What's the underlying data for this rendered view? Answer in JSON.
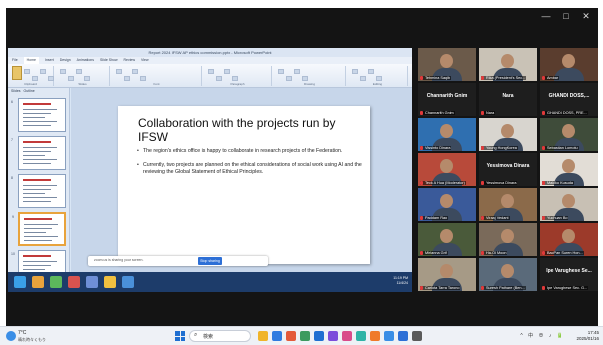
{
  "window": {
    "controls": [
      "—",
      "□",
      "✕"
    ]
  },
  "powerpoint": {
    "title": "Report 2024 IFSW AP ethics commission.pptx - Microsoft PowerPoint",
    "tabs": [
      "File",
      "Home",
      "Insert",
      "Design",
      "Animations",
      "Slide Show",
      "Review",
      "View"
    ],
    "active_tab": "Home",
    "ribbon_groups": [
      "Clipboard",
      "Slides",
      "Font",
      "Paragraph",
      "Drawing",
      "Editing"
    ],
    "thumb_tabs": [
      "Slides",
      "Outline"
    ],
    "thumb_numbers": [
      "6",
      "7",
      "8",
      "9",
      "10"
    ],
    "slide": {
      "title": "Collaboration with the projects run by IFSW",
      "bullets": [
        "The region's ethics office is happy to collaborate in research projects of the Federation.",
        "Currently, two projects are planned on the ethical considerations of social work using AI and the reviewing the Global Statement of Ethical Principles."
      ]
    },
    "notes_placeholder": "Click to add notes",
    "share_bar": {
      "text": "zoom.us is sharing your screen.",
      "stop_label": "Stop sharing"
    },
    "inner_clock": {
      "time": "11:19 PM",
      "date": "11/4/24"
    }
  },
  "gallery": {
    "tiles": [
      {
        "name": "Tehmina Saqib",
        "kind": "cam",
        "bg": "#6b5a4a"
      },
      {
        "name": "Rika (President's Sec...",
        "kind": "cam",
        "bg": "#c9c2b6"
      },
      {
        "name": "Ambar",
        "kind": "cam",
        "bg": "#5a3d2e"
      },
      {
        "name": "Channarith Gnim",
        "kind": "text",
        "bg": "#1e1e1e",
        "label": "Channarith Gnim"
      },
      {
        "name": "Nara",
        "kind": "text",
        "bg": "#1e1e1e",
        "label": "Nara"
      },
      {
        "name": "GHANDI DOSS, PRE...",
        "kind": "text",
        "bg": "#1e1e1e",
        "label": "GHANDI DOSS,..."
      },
      {
        "name": "Vissinto Dinara",
        "kind": "cam",
        "bg": "#2f6fb0"
      },
      {
        "name": "Young HongKorea",
        "kind": "cam",
        "bg": "#d8d5cf"
      },
      {
        "name": "Sebastian Lomotu",
        "kind": "cam",
        "bg": "#3f4c3a"
      },
      {
        "name": "Teck A Hua (Moderator)",
        "kind": "cam",
        "bg": "#b84a3a"
      },
      {
        "name": "Yessimova Dinara",
        "kind": "text",
        "bg": "#1e1e1e",
        "label": "Yessimova Dinara"
      },
      {
        "name": "Makiko Kusuda",
        "kind": "cam",
        "bg": "#e2ddd6"
      },
      {
        "name": "Paddam Rao",
        "kind": "cam",
        "bg": "#3a5a9a"
      },
      {
        "name": "Viraaj Vedant",
        "kind": "cam",
        "bg": "#8b6a4a"
      },
      {
        "name": "Yuchuan Bo",
        "kind": "cam",
        "bg": "#c8c0b4"
      },
      {
        "name": "Mirlanna Grif",
        "kind": "cam",
        "bg": "#4a5a3a"
      },
      {
        "name": "Ha-Ol Moon",
        "kind": "cam",
        "bg": "#7a6a5a"
      },
      {
        "name": "BacPan Suren Hon...",
        "kind": "cam",
        "bg": "#9c3a2a"
      },
      {
        "name": "Carlota Tarra Tarono",
        "kind": "cam",
        "bg": "#a69a86"
      },
      {
        "name": "Suresh Pathare (Ben...",
        "kind": "cam",
        "bg": "#5a6a7a"
      },
      {
        "name": "Ipe Varughese Sec. G...",
        "kind": "text",
        "bg": "#1e1e1e",
        "label": "Ipe Varughese Se..."
      }
    ]
  },
  "taskbar": {
    "weather_temp": "7°C",
    "weather_desc": "晴れ時々くもり",
    "search_placeholder": "検索",
    "tray": "^ 中 ⊕ ♪ 🔋",
    "time": "17:45",
    "date": "2025/01/16"
  },
  "colors": {
    "meeting_bg": "#141414",
    "ppt_blue": "#1d3c6a",
    "stop_button": "#2d6fd6",
    "windows_blue": "#1f6fd1"
  }
}
